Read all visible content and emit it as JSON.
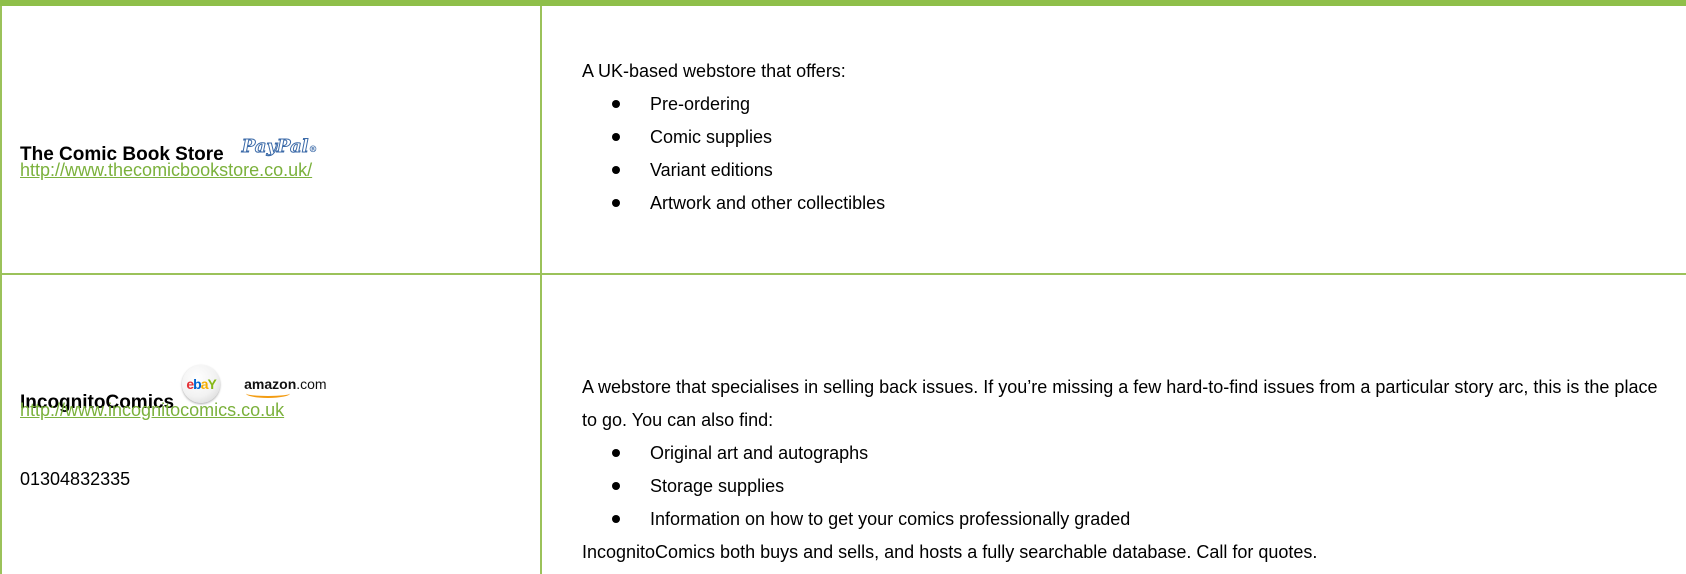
{
  "stores": [
    {
      "name": "The Comic Book Store",
      "logos": [
        "paypal-logo"
      ],
      "paypal_text": "PayPal",
      "url": "http://www.thecomicbookstore.co.uk/",
      "description": {
        "intro": "A UK-based webstore that offers:",
        "items": [
          "Pre-ordering",
          "Comic supplies",
          "Variant editions",
          "Artwork and other collectibles"
        ]
      }
    },
    {
      "name": "IncognitoComics",
      "logos": [
        "ebay-logo",
        "amazon-logo"
      ],
      "ebay_text": "ebY",
      "amazon_text": "amazon",
      "amazon_suffix": ".com",
      "url": "http://www.incognitocomics.co.uk",
      "phone": "01304832335",
      "description": {
        "intro": "A webstore that specialises in selling back issues.  If you’re missing a few hard-to-find issues from a particular story arc, this is the place to go.  You can also find:",
        "items": [
          "Original art and autographs",
          "Storage supplies",
          "Information on how to get your comics professionally graded"
        ],
        "outro": "IncognitoComics both buys and sells, and hosts a fully searchable database.  Call for quotes."
      }
    }
  ],
  "colors": {
    "border": "#9bc25a",
    "top_rule": "#8fbf4a",
    "link": "#7bb13c"
  }
}
